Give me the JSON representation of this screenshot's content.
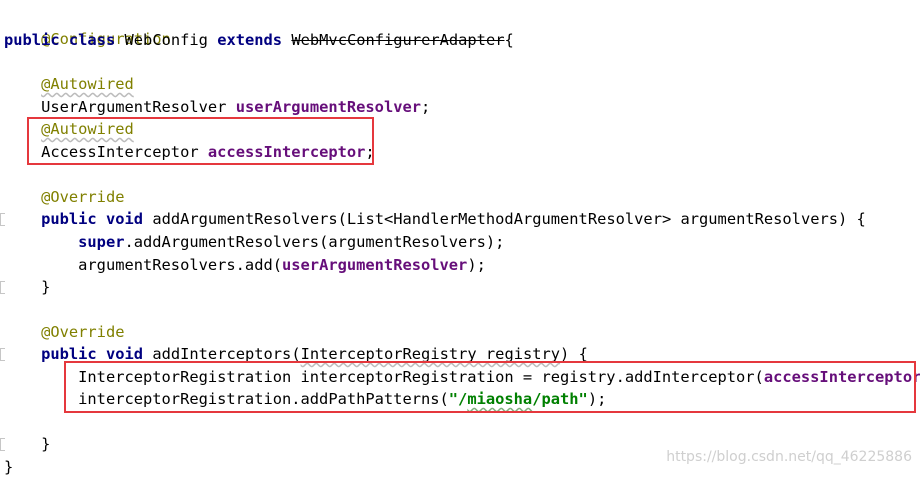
{
  "code": {
    "configuration_annotation": "@Configuration",
    "kw_public": "public",
    "kw_class": "class",
    "class_name": "WebConfig",
    "kw_extends": "extends",
    "parent_class": "WebMvcConfigurerAdapter",
    "open_brace": "{",
    "close_brace": "}",
    "autowired": "@Autowired",
    "override": "@Override",
    "resolver_type": "UserArgumentResolver",
    "resolver_field": "userArgumentResolver",
    "interceptor_type": "AccessInterceptor",
    "interceptor_field": "accessInterceptor",
    "semicolon": ";",
    "kw_void": "void",
    "kw_super": "super",
    "method1_sig": "addArgumentResolvers(List<HandlerMethodArgumentResolver> argumentResolvers) {",
    "method1_call": ".addArgumentResolvers(argumentResolvers);",
    "method1_add_prefix": "argumentResolvers.add(",
    "call_close": ");",
    "method2_sig_prefix": "addInterceptors(",
    "method2_sig_squiggle": "InterceptorRegistry registry",
    "method2_sig_suffix": ") {",
    "registration_prefix": "InterceptorRegistration interceptorRegistration = registry.addInterceptor(",
    "path_prefix": "interceptorRegistration.addPathPatterns(",
    "path_quote_open": "\"/",
    "path_squiggle": "miaosha",
    "path_quote_close": "/path\"",
    "path_suffix": ");"
  },
  "watermark": "https://blog.csdn.net/qq_46225886",
  "colors": {
    "annotation": "#808000",
    "keyword": "#000080",
    "field": "#660e7a",
    "string": "#008000",
    "highlight_box": "#e5383d"
  }
}
